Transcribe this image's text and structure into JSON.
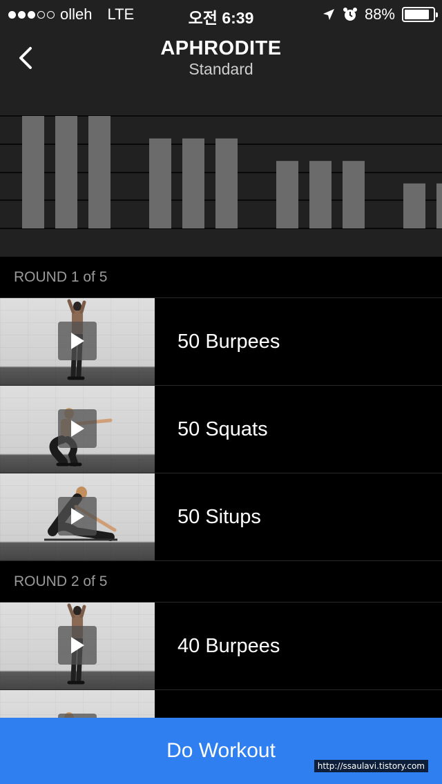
{
  "status_bar": {
    "carrier": "olleh",
    "network": "LTE",
    "time": "오전 6:39",
    "battery": "88%",
    "battery_level": 0.88,
    "icons": [
      "location-arrow-icon",
      "alarm-icon",
      "battery-icon"
    ]
  },
  "header": {
    "title": "APHRODITE",
    "subtitle": "Standard",
    "back_icon": "chevron-left-icon"
  },
  "chart_data": {
    "type": "bar",
    "groups": [
      {
        "round": 1,
        "values": [
          50,
          50,
          50
        ]
      },
      {
        "round": 2,
        "values": [
          40,
          40,
          40
        ]
      },
      {
        "round": 3,
        "values": [
          30,
          30,
          30
        ]
      },
      {
        "round": 4,
        "values": [
          20,
          20
        ]
      }
    ],
    "values": [
      50,
      50,
      50,
      40,
      40,
      40,
      30,
      30,
      30,
      20,
      20
    ],
    "ylim": [
      0,
      50
    ],
    "grid": true,
    "title": "",
    "xlabel": "",
    "ylabel": ""
  },
  "rounds": [
    {
      "label": "ROUND 1 of 5",
      "exercises": [
        {
          "label": "50 Burpees",
          "pose": "standing"
        },
        {
          "label": "50 Squats",
          "pose": "squat"
        },
        {
          "label": "50 Situps",
          "pose": "situp"
        }
      ]
    },
    {
      "label": "ROUND 2 of 5",
      "exercises": [
        {
          "label": "40 Burpees",
          "pose": "standing"
        },
        {
          "label": "",
          "pose": "squat"
        }
      ]
    }
  ],
  "footer": {
    "button_label": "Do Workout",
    "button_color": "#2f7ff0"
  },
  "watermark": "http://ssaulavi.tistory.com"
}
